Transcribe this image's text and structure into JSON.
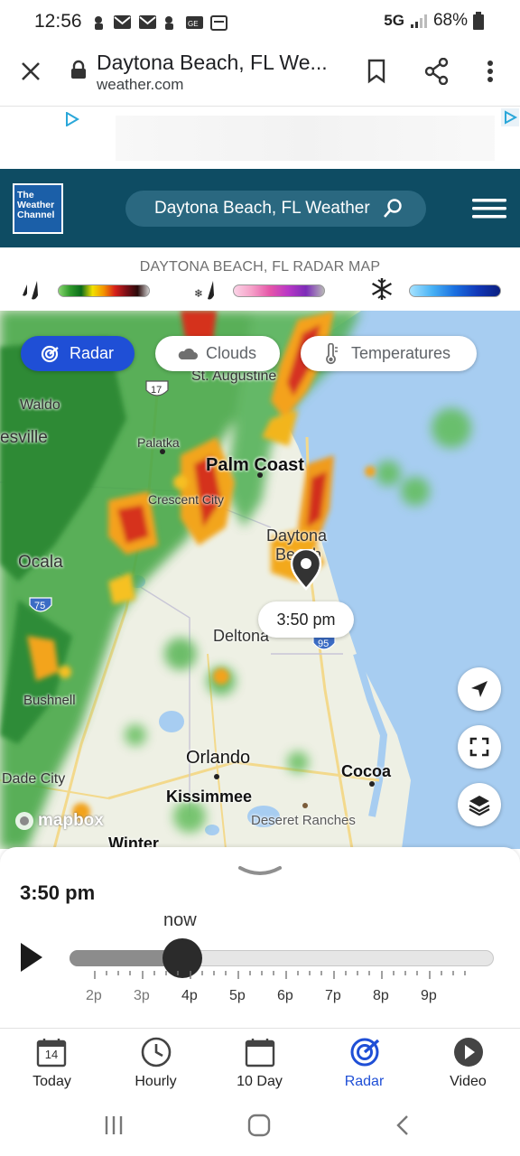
{
  "status_bar": {
    "time": "12:56",
    "network": "5G",
    "battery": "68%"
  },
  "browser": {
    "page_title": "Daytona Beach, FL We...",
    "url": "weather.com"
  },
  "header": {
    "logo_lines": [
      "The",
      "Weather",
      "Channel"
    ],
    "search_text": "Daytona Beach, FL Weather"
  },
  "radar": {
    "title": "DAYTONA BEACH, FL RADAR MAP",
    "layers": [
      {
        "label": "Radar",
        "active": true
      },
      {
        "label": "Clouds",
        "active": false
      },
      {
        "label": "Temperatures",
        "active": false
      }
    ],
    "time_callout": "3:50 pm",
    "attribution": "mapbox"
  },
  "map_labels": {
    "st_augustine": "St. Augustine",
    "waldo": "Waldo",
    "gainesville": "esville",
    "palatka": "Palatka",
    "palm_coast": "Palm Coast",
    "crescent_city": "Crescent City",
    "daytona": "Daytona",
    "beach": "Beach",
    "ocala": "Ocala",
    "deltona": "Deltona",
    "bushnell": "Bushnell",
    "orlando": "Orlando",
    "cocoa": "Cocoa",
    "dade_city": "Dade City",
    "kissimmee": "Kissimmee",
    "deseret": "Deseret Ranches",
    "winter": "Winter",
    "route_17": "17",
    "route_75": "75",
    "route_95": "95"
  },
  "timeline": {
    "current_time": "3:50 pm",
    "now_label": "now",
    "ticks": [
      "2p",
      "3p",
      "4p",
      "5p",
      "6p",
      "7p",
      "8p",
      "9p"
    ]
  },
  "bottom_nav": [
    {
      "label": "Today",
      "icon": "calendar-14-icon",
      "day": "14"
    },
    {
      "label": "Hourly",
      "icon": "clock-icon"
    },
    {
      "label": "10 Day",
      "icon": "calendar-icon"
    },
    {
      "label": "Radar",
      "icon": "radar-icon",
      "active": true
    },
    {
      "label": "Video",
      "icon": "play-circle-icon"
    }
  ],
  "colors": {
    "header_bg": "#0e4c63",
    "accent_blue": "#1f4fd6",
    "water": "#a7cdf1"
  }
}
